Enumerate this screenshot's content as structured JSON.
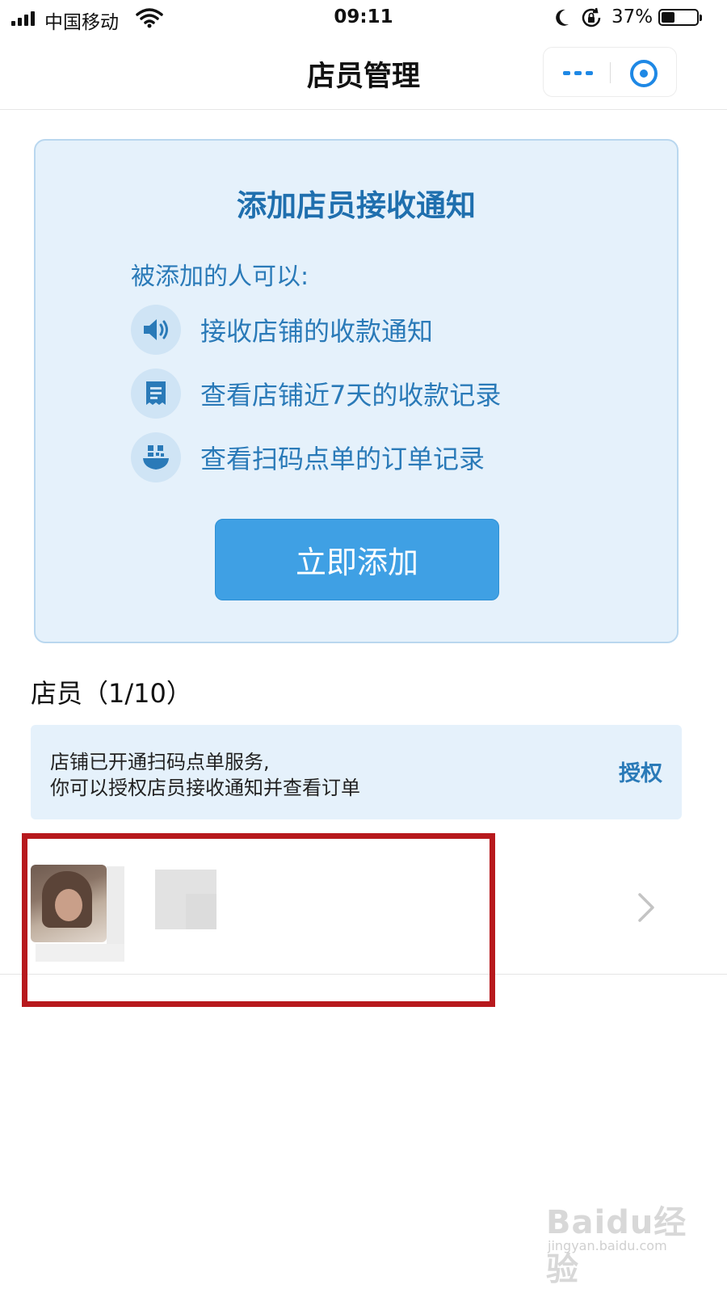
{
  "status_bar": {
    "carrier": "中国移动",
    "time": "09:11",
    "battery_percent": "37%",
    "battery_level": 0.37
  },
  "nav": {
    "title": "店员管理"
  },
  "card": {
    "title": "添加店员接收通知",
    "subtitle": "被添加的人可以:",
    "features": [
      {
        "icon": "speaker-icon",
        "text": "接收店铺的收款通知"
      },
      {
        "icon": "receipt-icon",
        "text": "查看店铺近7天的收款记录"
      },
      {
        "icon": "qr-bowl-icon",
        "text": "查看扫码点单的订单记录"
      }
    ],
    "button_label": "立即添加"
  },
  "staff_section": {
    "title": "店员（1/10）"
  },
  "notice": {
    "line1": "店铺已开通扫码点单服务,",
    "line2": "你可以授权店员接收通知并查看订单",
    "action": "授权"
  },
  "watermark": {
    "brand": "Baidu经验",
    "url": "jingyan.baidu.com"
  },
  "colors": {
    "accent": "#3fa0e4",
    "card_bg": "#e5f1fb",
    "title_blue": "#1f6fae",
    "highlight_red": "#b7191d"
  }
}
